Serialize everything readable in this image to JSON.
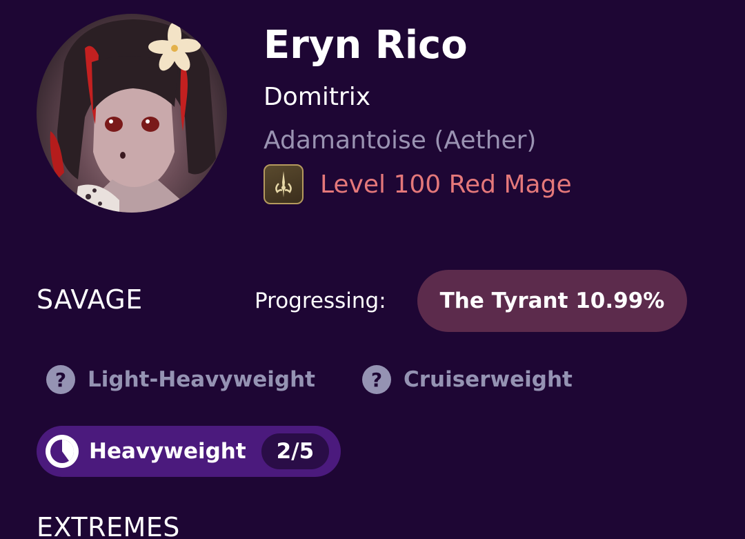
{
  "character": {
    "name": "Eryn Rico",
    "title": "Domitrix",
    "server": "Adamantoise (Aether)",
    "job_icon": "red-mage-job-icon",
    "job_text": "Level 100 Red Mage"
  },
  "savage": {
    "section_label": "SAVAGE",
    "progress_label": "Progressing:",
    "progress_value": "The Tyrant 10.99%",
    "tiers": [
      {
        "label": "Light-Heavyweight",
        "icon": "question-icon"
      },
      {
        "label": "Cruiserweight",
        "icon": "question-icon"
      }
    ],
    "current": {
      "label": "Heavyweight",
      "count": "2/5",
      "cleared": 2,
      "total": 5
    }
  },
  "extremes": {
    "section_label": "EXTREMES"
  },
  "colors": {
    "background": "#1e0634",
    "progress_pill": "#5c2b4c",
    "current_pill": "#4b1a7d",
    "job_text": "#e4787a",
    "muted_text": "#9593b3"
  }
}
